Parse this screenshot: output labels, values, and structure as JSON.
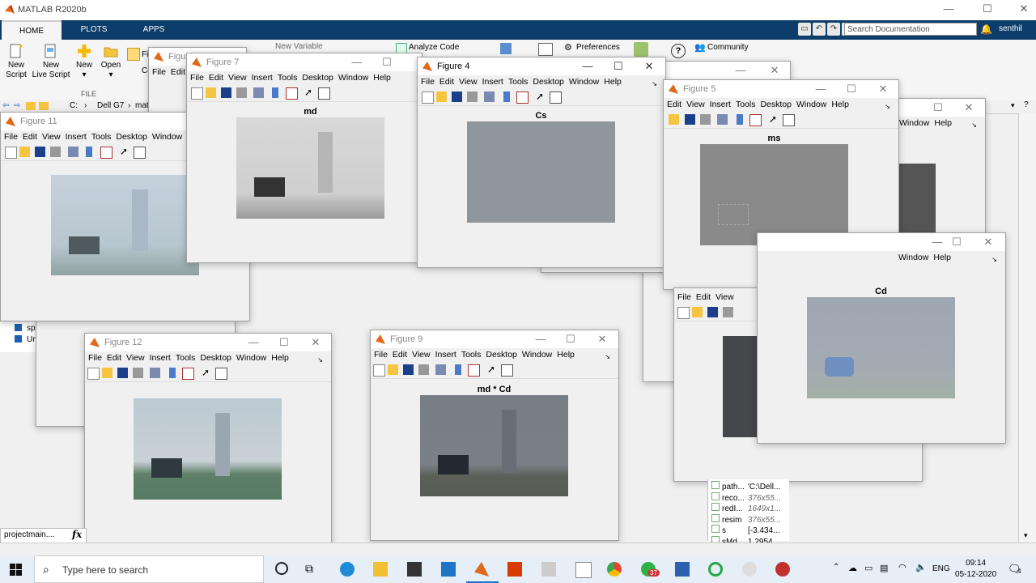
{
  "app": {
    "title": "MATLAB R2020b",
    "tabs": [
      "HOME",
      "PLOTS",
      "APPS"
    ],
    "search_placeholder": "Search Documentation",
    "user": "senthil",
    "ribbon": {
      "new_script": "New\nScript",
      "new_live_script": "New\nLive Script",
      "new": "New",
      "open": "Open",
      "file_label": "FILE",
      "new_variable": "New Variable",
      "analyze_code": "Analyze Code",
      "preferences": "Preferences",
      "community": "Community",
      "find_files": "Fi",
      "co": "Co"
    },
    "path": [
      "C:",
      "Dell G7",
      "mat"
    ]
  },
  "menu": [
    "File",
    "Edit",
    "View",
    "Insert",
    "Tools",
    "Desktop",
    "Window",
    "Help"
  ],
  "figures": {
    "fig7": {
      "title": "Figure 7",
      "axes_title": "md"
    },
    "fig4": {
      "title": "Figure 4",
      "axes_title": "Cs"
    },
    "fig5": {
      "title": "Figure 5",
      "axes_title": "ms"
    },
    "fig11": {
      "title": "Figure 11"
    },
    "fig12": {
      "title": "Figure 12"
    },
    "fig9": {
      "title": "Figure 9",
      "axes_title": "md * Cd"
    },
    "figCd": {
      "axes_title": "Cd"
    },
    "figBack": {
      "title": "Figure"
    }
  },
  "workspace": [
    {
      "name": "path...",
      "value": "'C:\\Dell..."
    },
    {
      "name": "reco...",
      "value": "376x55..."
    },
    {
      "name": "redI...",
      "value": "1649x1..."
    },
    {
      "name": "resim",
      "value": "376x55..."
    },
    {
      "name": "s",
      "value": "[-3.434..."
    },
    {
      "name": "sMd",
      "value": "1.2954..."
    }
  ],
  "current_folder_items": [
    "sp",
    "Un"
  ],
  "command_file": "projectmain....",
  "fx": "fx",
  "taskbar": {
    "search": "Type here to search",
    "lang": "ENG",
    "time": "09:14",
    "date": "05-12-2020",
    "notif_count": "37",
    "action_count": "4"
  },
  "colors": {
    "ribbon_tabs_bg": "#0d3d6b",
    "cs_fill": "#8f969c",
    "ms_fill": "#8a8a8a"
  }
}
